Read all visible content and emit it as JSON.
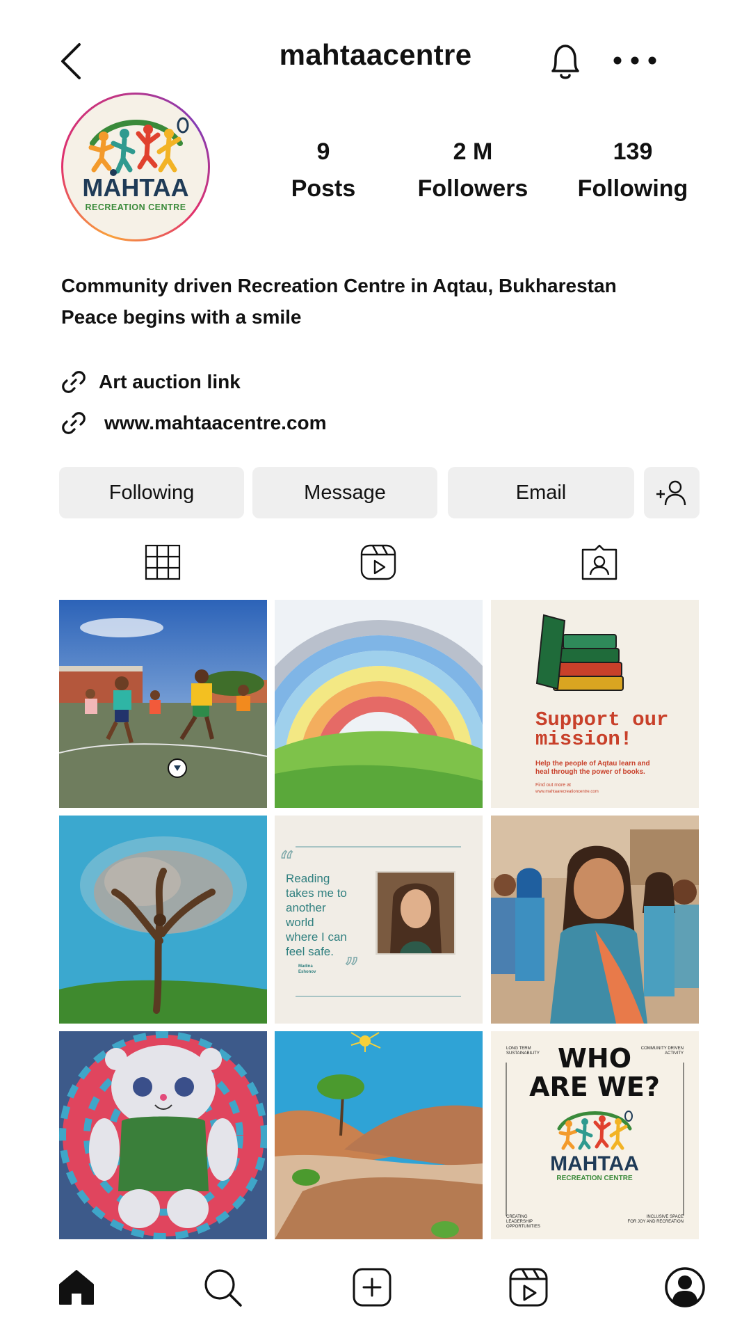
{
  "header": {
    "username": "mahtaacentre",
    "icons": {
      "back": "chevron-left-icon",
      "notifications": "bell-icon",
      "more": "more-horizontal-icon"
    }
  },
  "profile": {
    "avatar_logo": {
      "line1": "MAHTAA",
      "line2": "RECREATION CENTRE"
    },
    "stats": {
      "posts": {
        "value": "9",
        "label": "Posts"
      },
      "followers": {
        "value": "2 M",
        "label": "Followers"
      },
      "following": {
        "value": "139",
        "label": "Following"
      }
    },
    "bio": {
      "line1": "Community driven Recreation Centre in Aqtau, Bukharestan",
      "line2": "Peace begins with a smile"
    },
    "links": [
      {
        "text": "Art auction link",
        "icon": "link-icon"
      },
      {
        "text": "www.mahtaacentre.com",
        "icon": "link-icon"
      }
    ]
  },
  "actions": {
    "following": "Following",
    "message": "Message",
    "email": "Email",
    "add_user_icon": "add-user-icon"
  },
  "tabs": [
    {
      "icon": "grid-icon",
      "active": true
    },
    {
      "icon": "reels-icon",
      "active": false
    },
    {
      "icon": "tagged-icon",
      "active": false
    }
  ],
  "posts": {
    "mission": {
      "title_line1": "Support our",
      "title_line2": "mission!",
      "body_line1": "Help the people of Aqtau learn and",
      "body_line2": "heal through the power of books.",
      "find_more": "Find out more at",
      "url": "www.mahtaarecreationcentre.com"
    },
    "quote": {
      "line1": "Reading",
      "line2": "takes me to",
      "line3": "another",
      "line4": "world",
      "line5": "where I can",
      "line6": "feel safe.",
      "author1": "Madina",
      "author2": "Eshonov"
    },
    "who": {
      "top_left1": "LONG TERM",
      "top_left2": "SUSTAINABILITY",
      "top_right1": "COMMUNITY DRIVEN",
      "top_right2": "ACTIVITY",
      "title1": "WHO",
      "title2": "ARE WE?",
      "logo1": "MAHTAA",
      "logo2": "RECREATION CENTRE",
      "bottom_left1": "CREATING",
      "bottom_left2": "LEADERSHIP",
      "bottom_left3": "OPPORTUNITIES",
      "bottom_right1": "INCLUSIVE SPACE",
      "bottom_right2": "FOR JOY AND RECREATION"
    }
  },
  "nav": [
    {
      "icon": "home-icon",
      "active": true
    },
    {
      "icon": "search-icon",
      "active": false
    },
    {
      "icon": "create-icon",
      "active": false
    },
    {
      "icon": "reels-icon",
      "active": false
    },
    {
      "icon": "profile-icon",
      "active": false
    }
  ],
  "colors": {
    "button_bg": "#efefef",
    "logo_navy": "#1f3b57",
    "logo_green": "#3a8a3a",
    "mission_red": "#c8402a"
  }
}
